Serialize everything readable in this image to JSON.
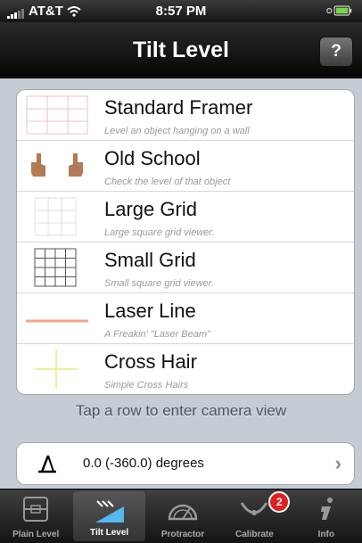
{
  "status_bar": {
    "carrier": "AT&T",
    "time": "8:57 PM"
  },
  "nav": {
    "title": "Tilt Level",
    "help_label": "?"
  },
  "rows": [
    {
      "title": "Standard Framer",
      "subtitle": "Level an object hanging on a wall",
      "icon": "framer-grid-icon"
    },
    {
      "title": "Old School",
      "subtitle": "Check the level of that object",
      "icon": "hands-icon"
    },
    {
      "title": "Large Grid",
      "subtitle": "Large square grid viewer.",
      "icon": "large-grid-icon"
    },
    {
      "title": "Small Grid",
      "subtitle": "Small square grid viewer.",
      "icon": "small-grid-icon"
    },
    {
      "title": "Laser Line",
      "subtitle": "A Freakin' \"Laser Beam\"",
      "icon": "laser-line-icon"
    },
    {
      "title": "Cross Hair",
      "subtitle": "Simple Cross Hairs",
      "icon": "cross-hair-icon"
    }
  ],
  "hint": "Tap a row to enter camera view",
  "readout": {
    "value": "0.0  (-360.0) degrees"
  },
  "tabs": [
    {
      "label": "Plain Level"
    },
    {
      "label": "Tilt Level"
    },
    {
      "label": "Protractor"
    },
    {
      "label": "Calibrate",
      "badge": "2"
    },
    {
      "label": "Info"
    }
  ],
  "colors": {
    "laser": "#f4a48a",
    "crosshair": "#e7ec7a",
    "framer": "#f2c0c0",
    "badge": "#e02020"
  }
}
